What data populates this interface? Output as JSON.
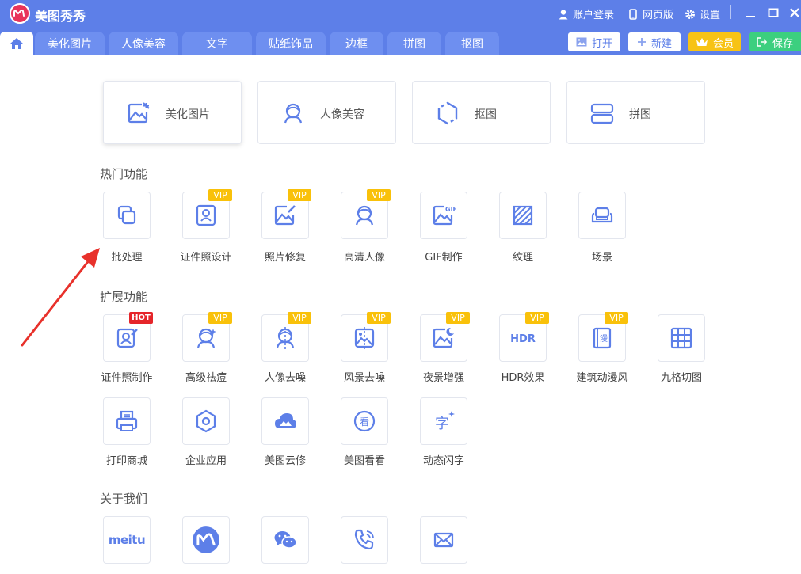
{
  "app": {
    "title": "美图秀秀"
  },
  "titlebar": {
    "login": "账户登录",
    "web": "网页版",
    "settings": "设置"
  },
  "tabs": [
    "美化图片",
    "人像美容",
    "文字",
    "贴纸饰品",
    "边框",
    "拼图",
    "抠图"
  ],
  "toolbar": {
    "open": "打开",
    "new": "新建",
    "vip": "会员",
    "save": "保存"
  },
  "cards": [
    "美化图片",
    "人像美容",
    "抠图",
    "拼图"
  ],
  "sections": {
    "hot": "热门功能",
    "ext": "扩展功能",
    "about": "关于我们"
  },
  "hot_items": [
    "批处理",
    "证件照设计",
    "照片修复",
    "高清人像",
    "GIF制作",
    "纹理",
    "场景"
  ],
  "ext_row1": [
    "证件照制作",
    "高级祛痘",
    "人像去噪",
    "风景去噪",
    "夜景增强",
    "HDR效果",
    "建筑动漫风",
    "九格切图"
  ],
  "ext_row2": [
    "打印商城",
    "企业应用",
    "美图云修",
    "美图看看",
    "动态闪字"
  ],
  "badges": {
    "vip": "VIP",
    "hot": "HOT"
  },
  "about_logo_text": "meitu",
  "icon_text": {
    "hdr": "HDR",
    "gif": "GIF",
    "manga": "漫",
    "look": "看",
    "zi": "字"
  },
  "colors": {
    "primary": "#5d7fe8",
    "vip": "#f9c10a",
    "hot": "#e5252a",
    "save": "#3ccf7f",
    "icon": "#5d7fe8",
    "arrow": "#e8312b"
  }
}
